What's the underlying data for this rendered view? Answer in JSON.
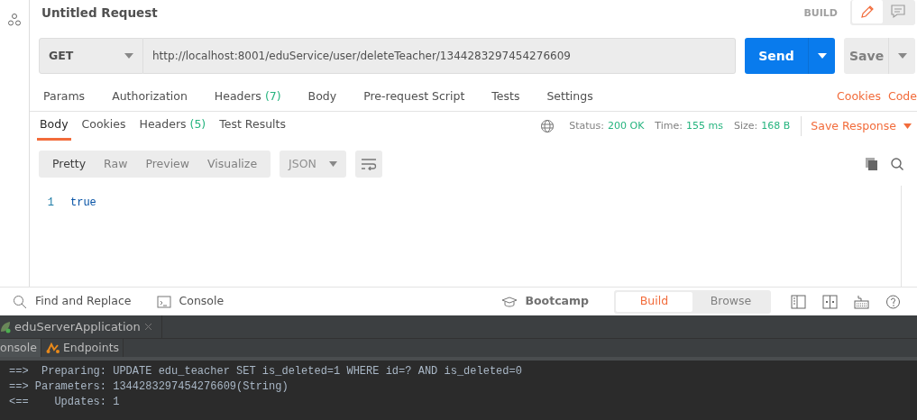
{
  "request": {
    "title": "Untitled Request",
    "mode_label": "BUILD",
    "view_buttons": [
      {
        "kind": "edit",
        "selected": true
      },
      {
        "kind": "comments",
        "selected": false
      }
    ],
    "method": "GET",
    "url": "http://localhost:8001/eduService/user/deleteTeacher/1344283297454276609",
    "send_label": "Send",
    "save_label": "Save"
  },
  "request_tabs": [
    {
      "label": "Params"
    },
    {
      "label": "Authorization"
    },
    {
      "label": "Headers",
      "count": "(7)"
    },
    {
      "label": "Body"
    },
    {
      "label": "Pre-request Script"
    },
    {
      "label": "Tests"
    },
    {
      "label": "Settings"
    }
  ],
  "request_links": [
    "Cookies",
    "Code"
  ],
  "response_tabs": [
    {
      "label": "Body",
      "selected": true
    },
    {
      "label": "Cookies",
      "selected": false
    },
    {
      "label": "Headers",
      "count": "(5)",
      "selected": false
    },
    {
      "label": "Test Results",
      "selected": false
    }
  ],
  "response_meta": [
    {
      "label": "Status:",
      "value": "200 OK"
    },
    {
      "label": "Time:",
      "value": "155 ms"
    },
    {
      "label": "Size:",
      "value": "168 B"
    }
  ],
  "save_response_label": "Save Response",
  "format_tabs": [
    {
      "label": "Pretty",
      "selected": true
    },
    {
      "label": "Raw",
      "selected": false
    },
    {
      "label": "Preview",
      "selected": false
    },
    {
      "label": "Visualize",
      "selected": false
    }
  ],
  "format_type": "JSON",
  "editor_lines": [
    {
      "number": "1",
      "text": "true"
    }
  ],
  "bottom_bar": {
    "left": [
      {
        "kind": "search",
        "label": "Find and Replace"
      },
      {
        "kind": "console",
        "label": "Console"
      }
    ],
    "bootcamp": "Bootcamp",
    "modes": [
      {
        "label": "Build",
        "selected": true
      },
      {
        "label": "Browse",
        "selected": false
      }
    ]
  },
  "ide": {
    "run_tab": "eduServerApplication",
    "tool_tabs": [
      {
        "kind": "console",
        "label": "onsole",
        "selected": true
      },
      {
        "kind": "endpoints",
        "label": "Endpoints",
        "selected": false
      }
    ],
    "console_lines": [
      "==>  Preparing: UPDATE edu_teacher SET is_deleted=1 WHERE id=? AND is_deleted=0",
      "==> Parameters: 1344283297454276609(String)",
      "<==    Updates: 1"
    ]
  }
}
